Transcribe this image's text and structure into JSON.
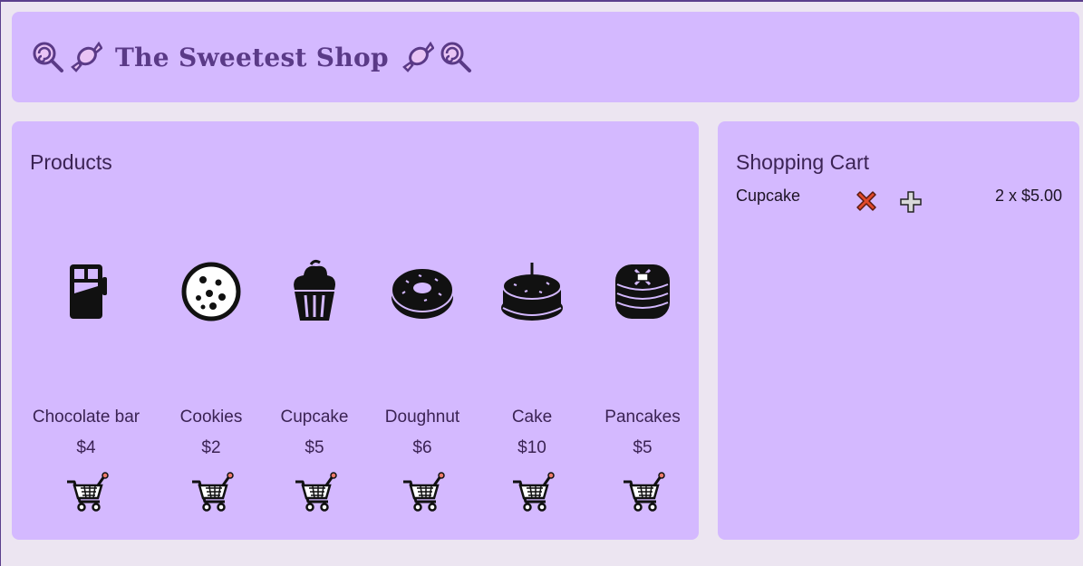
{
  "header": {
    "title": "The Sweetest Shop",
    "left_icons": [
      "lollipop-icon",
      "candy-icon"
    ],
    "right_icons": [
      "candy-icon",
      "lollipop-icon"
    ]
  },
  "products": {
    "title": "Products",
    "items": [
      {
        "name": "Chocolate bar",
        "price": "$4",
        "icon": "chocolate-bar-icon"
      },
      {
        "name": "Cookies",
        "price": "$2",
        "icon": "cookie-icon"
      },
      {
        "name": "Cupcake",
        "price": "$5",
        "icon": "cupcake-icon"
      },
      {
        "name": "Doughnut",
        "price": "$6",
        "icon": "doughnut-icon"
      },
      {
        "name": "Cake",
        "price": "$10",
        "icon": "cake-icon"
      },
      {
        "name": "Pancakes",
        "price": "$5",
        "icon": "pancakes-icon"
      }
    ],
    "add_icon": "shopping-cart-icon"
  },
  "cart": {
    "title": "Shopping Cart",
    "items": [
      {
        "name": "Cupcake",
        "quantity_text": "2 x $5.00"
      }
    ],
    "remove_icon": "cross-mark-icon",
    "add_icon": "plus-icon"
  },
  "colors": {
    "panel": "#d4b9ff",
    "background": "#ece5f1",
    "title": "#5a3a87",
    "remove": "#e0492b"
  }
}
